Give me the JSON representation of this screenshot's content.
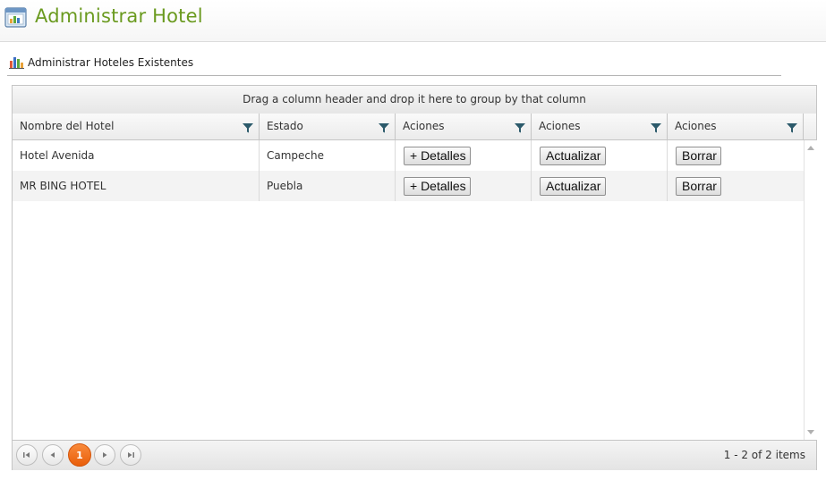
{
  "header": {
    "title": "Administrar Hotel",
    "icon": "window-chart-icon"
  },
  "section": {
    "title": "Administrar Hoteles Existentes",
    "icon": "bar-chart-icon"
  },
  "grid": {
    "group_hint": "Drag a column header and drop it here to group by that column",
    "columns": [
      "Nombre del Hotel",
      "Estado",
      "Aciones",
      "Aciones",
      "Aciones"
    ],
    "rows": [
      {
        "name": "Hotel Avenida",
        "state": "Campeche",
        "details": "+ Detalles",
        "update": "Actualizar",
        "delete": "Borrar"
      },
      {
        "name": "MR BING HOTEL",
        "state": "Puebla",
        "details": "+ Detalles",
        "update": "Actualizar",
        "delete": "Borrar"
      }
    ]
  },
  "pager": {
    "current_page": "1",
    "first_icon": "first-page-icon",
    "prev_icon": "prev-page-icon",
    "next_icon": "next-page-icon",
    "last_icon": "last-page-icon",
    "info": "1 - 2 of 2 items"
  },
  "colors": {
    "title": "#6a9a1f",
    "current_page": "#f47a25",
    "filter_icon": "#2c5a6b"
  }
}
